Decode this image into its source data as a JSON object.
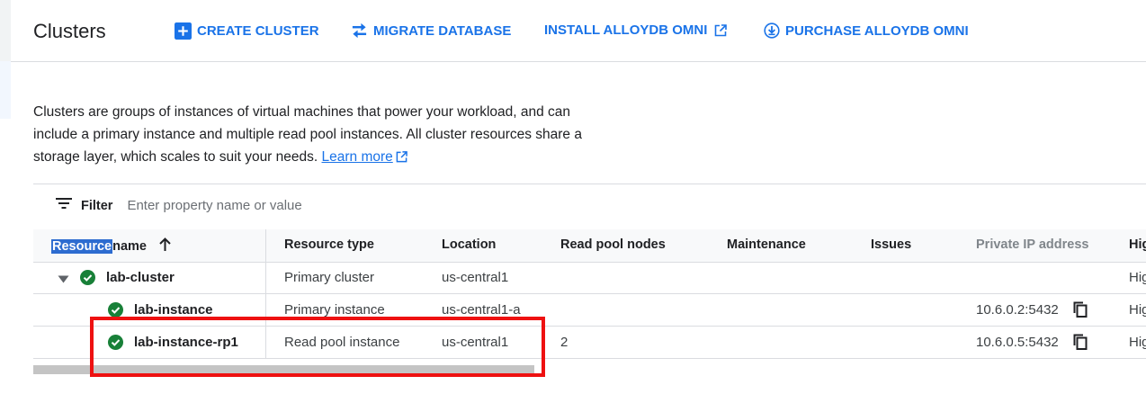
{
  "header": {
    "title": "Clusters",
    "actions": [
      {
        "label": "CREATE CLUSTER",
        "icon": "add-box-icon"
      },
      {
        "label": "MIGRATE DATABASE",
        "icon": "swap-arrows-icon"
      },
      {
        "label": "INSTALL ALLOYDB OMNI",
        "icon": "external-link-icon"
      },
      {
        "label": "PURCHASE ALLOYDB OMNI",
        "icon": "download-circle-icon"
      }
    ]
  },
  "description": {
    "text": "Clusters are groups of instances of virtual machines that power your workload, and can include a primary instance and multiple read pool instances. All cluster resources share a storage layer, which scales to suit your needs.",
    "link_label": "Learn more"
  },
  "filter": {
    "label": "Filter",
    "placeholder": "Enter property name or value"
  },
  "table": {
    "columns": {
      "resource_name_highlight": "Resource",
      "resource_name_rest": "name",
      "resource_type": "Resource type",
      "location": "Location",
      "read_pool_nodes": "Read pool nodes",
      "maintenance": "Maintenance",
      "issues": "Issues",
      "private_ip": "Private IP address",
      "high_availability_truncated": "Hig"
    },
    "rows": [
      {
        "name": "lab-cluster",
        "type": "Primary cluster",
        "location": "us-central1",
        "read_pool_nodes": "",
        "ip": "",
        "ha": "Hig",
        "status": "ready"
      },
      {
        "name": "lab-instance",
        "type": "Primary instance",
        "location": "us-central1-a",
        "read_pool_nodes": "",
        "ip": "10.6.0.2:5432",
        "ha": "Hig",
        "status": "ready"
      },
      {
        "name": "lab-instance-rp1",
        "type": "Read pool instance",
        "location": "us-central1",
        "read_pool_nodes": "2",
        "ip": "10.6.0.5:5432",
        "ha": "Hig",
        "status": "ready"
      }
    ]
  },
  "colors": {
    "accent": "#1a73e8",
    "success": "#188038",
    "annotation": "#ee1111",
    "text": "#202124",
    "muted": "#5f6368"
  }
}
